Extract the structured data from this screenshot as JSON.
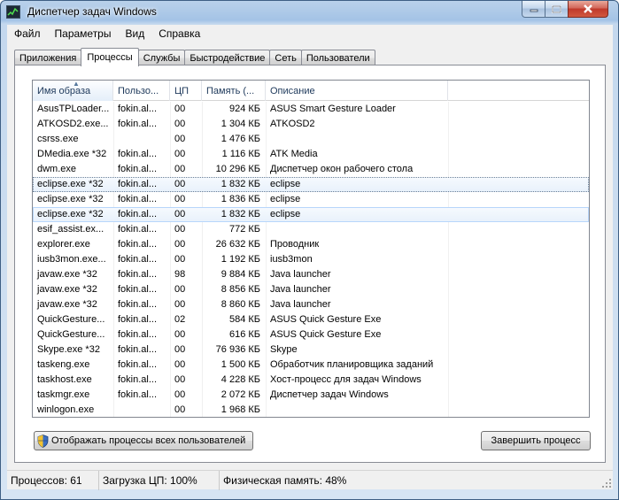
{
  "window": {
    "title": "Диспетчер задач Windows"
  },
  "menu": [
    "Файл",
    "Параметры",
    "Вид",
    "Справка"
  ],
  "tabs": [
    "Приложения",
    "Процессы",
    "Службы",
    "Быстродействие",
    "Сеть",
    "Пользователи"
  ],
  "active_tab": 1,
  "columns": [
    "Имя образа",
    "Пользо...",
    "ЦП",
    "Память (...",
    "Описание"
  ],
  "rows": [
    {
      "name": "AsusTPLoader...",
      "user": "fokin.al...",
      "cpu": "00",
      "mem": "924 КБ",
      "desc": "ASUS Smart Gesture Loader"
    },
    {
      "name": "ATKOSD2.exe...",
      "user": "fokin.al...",
      "cpu": "00",
      "mem": "1 304 КБ",
      "desc": "ATKOSD2"
    },
    {
      "name": "csrss.exe",
      "user": "",
      "cpu": "00",
      "mem": "1 476 КБ",
      "desc": ""
    },
    {
      "name": "DMedia.exe *32",
      "user": "fokin.al...",
      "cpu": "00",
      "mem": "1 116 КБ",
      "desc": "ATK Media"
    },
    {
      "name": "dwm.exe",
      "user": "fokin.al...",
      "cpu": "00",
      "mem": "10 296 КБ",
      "desc": "Диспетчер окон рабочего стола"
    },
    {
      "name": "eclipse.exe *32",
      "user": "fokin.al...",
      "cpu": "00",
      "mem": "1 832 КБ",
      "desc": "eclipse"
    },
    {
      "name": "eclipse.exe *32",
      "user": "fokin.al...",
      "cpu": "00",
      "mem": "1 836 КБ",
      "desc": "eclipse"
    },
    {
      "name": "eclipse.exe *32",
      "user": "fokin.al...",
      "cpu": "00",
      "mem": "1 832 КБ",
      "desc": "eclipse"
    },
    {
      "name": "esif_assist.ex...",
      "user": "fokin.al...",
      "cpu": "00",
      "mem": "772 КБ",
      "desc": ""
    },
    {
      "name": "explorer.exe",
      "user": "fokin.al...",
      "cpu": "00",
      "mem": "26 632 КБ",
      "desc": "Проводник"
    },
    {
      "name": "iusb3mon.exe...",
      "user": "fokin.al...",
      "cpu": "00",
      "mem": "1 192 КБ",
      "desc": "iusb3mon"
    },
    {
      "name": "javaw.exe *32",
      "user": "fokin.al...",
      "cpu": "98",
      "mem": "9 884 КБ",
      "desc": "Java launcher"
    },
    {
      "name": "javaw.exe *32",
      "user": "fokin.al...",
      "cpu": "00",
      "mem": "8 856 КБ",
      "desc": "Java launcher"
    },
    {
      "name": "javaw.exe *32",
      "user": "fokin.al...",
      "cpu": "00",
      "mem": "8 860 КБ",
      "desc": "Java launcher"
    },
    {
      "name": "QuickGesture...",
      "user": "fokin.al...",
      "cpu": "02",
      "mem": "584 КБ",
      "desc": "ASUS Quick Gesture Exe"
    },
    {
      "name": "QuickGesture...",
      "user": "fokin.al...",
      "cpu": "00",
      "mem": "616 КБ",
      "desc": "ASUS Quick Gesture Exe"
    },
    {
      "name": "Skype.exe *32",
      "user": "fokin.al...",
      "cpu": "00",
      "mem": "76 936 КБ",
      "desc": "Skype"
    },
    {
      "name": "taskeng.exe",
      "user": "fokin.al...",
      "cpu": "00",
      "mem": "1 500 КБ",
      "desc": "Обработчик планировщика заданий"
    },
    {
      "name": "taskhost.exe",
      "user": "fokin.al...",
      "cpu": "00",
      "mem": "4 228 КБ",
      "desc": "Хост-процесс для задач Windows"
    },
    {
      "name": "taskmgr.exe",
      "user": "fokin.al...",
      "cpu": "00",
      "mem": "2 072 КБ",
      "desc": "Диспетчер задач Windows"
    },
    {
      "name": "winlogon.exe",
      "user": "",
      "cpu": "00",
      "mem": "1 968 КБ",
      "desc": ""
    }
  ],
  "focused_row": 5,
  "selected_row": 7,
  "buttons": {
    "show_all": "Отображать процессы всех пользователей",
    "end_process": "Завершить процесс"
  },
  "status": {
    "processes": "Процессов: 61",
    "cpu": "Загрузка ЦП: 100%",
    "memory": "Физическая память: 48%"
  },
  "icons": {
    "app": "task-manager-icon",
    "shield": "uac-shield-icon",
    "sort": "sort-ascending-icon"
  }
}
